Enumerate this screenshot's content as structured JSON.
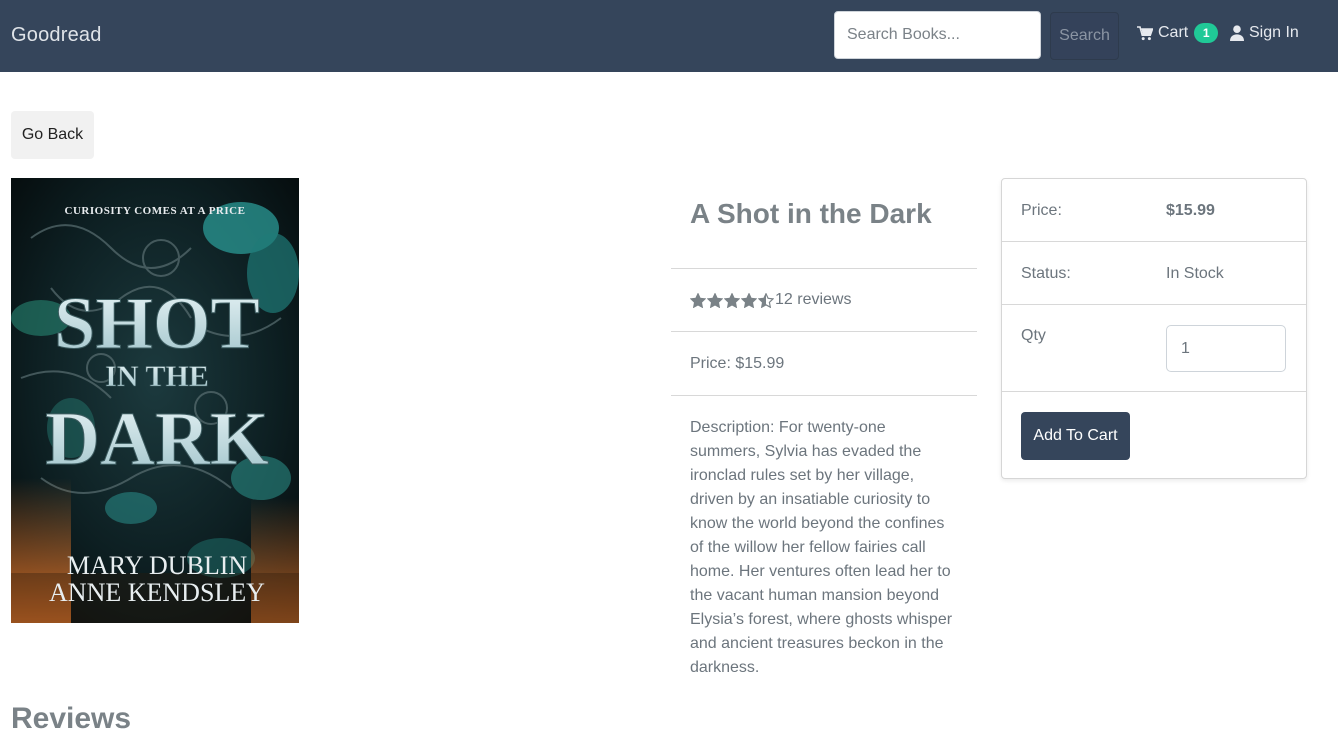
{
  "navbar": {
    "brand": "Goodread",
    "search_placeholder": "Search Books...",
    "search_button": "Search",
    "cart_label": "Cart",
    "cart_count": "1",
    "signin_label": "Sign In"
  },
  "go_back_label": "Go Back",
  "cover": {
    "tagline": "CURIOSITY COMES AT A PRICE",
    "title_line1": "SHOT",
    "title_line2": "IN THE",
    "title_line3": "DARK",
    "author_line1": "MARY DUBLIN",
    "author_line2": "ANNE KENDSLEY"
  },
  "product": {
    "title": "A Shot in the Dark",
    "rating": 4.5,
    "reviews_text": "12 reviews",
    "price_text": "Price: $15.99",
    "description": "Description: For twenty-one summers, Sylvia has evaded the ironclad rules set by her village, driven by an insatiable curiosity to know the world beyond the confines of the willow her fellow fairies call home. Her ventures often lead her to the vacant human mansion beyond Elysia’s forest, where ghosts whisper and ancient treasures beckon in the darkness."
  },
  "card": {
    "price_label": "Price:",
    "price_value": "$15.99",
    "status_label": "Status:",
    "status_value": "In Stock",
    "qty_label": "Qty",
    "qty_value": "1",
    "add_button": "Add To Cart"
  },
  "reviews_heading": "Reviews",
  "colors": {
    "navbar": "#35455b",
    "badge": "#20c997",
    "text_muted": "#6c757d"
  }
}
